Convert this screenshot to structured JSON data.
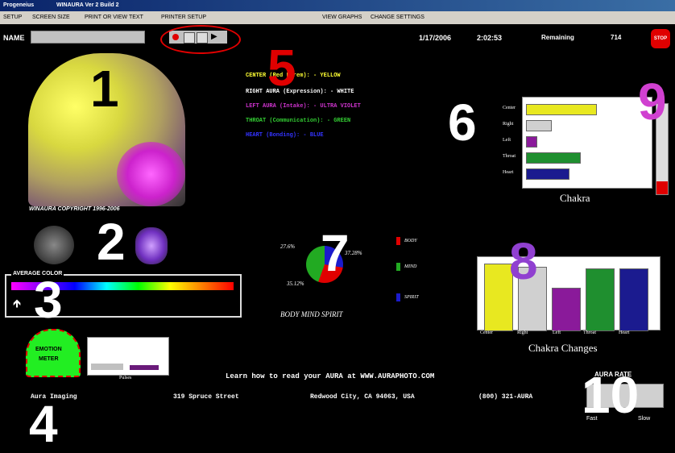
{
  "window": {
    "title_app": "Progeneius",
    "title_doc": "WINAURA Ver 2 Build 2"
  },
  "menu": {
    "items": [
      "SETUP",
      "SCREEN SIZE",
      "PRINT OR VIEW TEXT",
      "PRINTER SETUP",
      "VIEW GRAPHS",
      "CHANGE SETTINGS"
    ]
  },
  "toolbar": {
    "name_label": "NAME",
    "name_value": "",
    "date": "1/17/2006",
    "time": "2:02:53",
    "remaining_label": "Remaining",
    "remaining_value": "714",
    "stop_label": "STOP"
  },
  "annotations": [
    "1",
    "2",
    "3",
    "4",
    "5",
    "6",
    "7",
    "8",
    "9",
    "10"
  ],
  "copyright": "WINAURA COPYRIGHT 1996-2006",
  "chakra_legend": [
    {
      "label": "CENTER (Red Lorem): - YELLOW",
      "color": "#ffff33"
    },
    {
      "label": "RIGHT AURA (Expression): - WHITE",
      "color": "#ffffff"
    },
    {
      "label": "LEFT AURA (Intake): - ULTRA VIOLET",
      "color": "#cc33cc"
    },
    {
      "label": "THROAT (Communication): - GREEN",
      "color": "#33cc33"
    },
    {
      "label": "HEART (Bonding): - BLUE",
      "color": "#3333ff"
    }
  ],
  "average_color_label": "AVERAGE COLOR",
  "emotion_meter": {
    "label_top": "EMOTION",
    "label_bottom": "METER"
  },
  "small_chart_label": "Pulses",
  "pie": {
    "body_pct": "27.6%",
    "mind_pct": "37.28%",
    "spirit_pct": "35.12%",
    "caption": "BODY MIND SPIRIT",
    "legend": [
      "BODY",
      "MIND",
      "SPIRIT"
    ]
  },
  "chakra_hbar": {
    "caption": "Chakra",
    "labels": [
      "Center",
      "Right",
      "Left",
      "Throat",
      "Heart"
    ]
  },
  "chakra_changes": {
    "caption": "Chakra Changes",
    "labels": [
      "Center",
      "Right",
      "Left",
      "Throat",
      "Heart"
    ]
  },
  "footer": {
    "learn": "Learn how to read your AURA at WWW.AURAPHOTO.COM",
    "company": "Aura Imaging",
    "street": "319 Spruce Street",
    "city": "Redwood City, CA  94063, USA",
    "phone": "(800) 321-AURA",
    "aura_rate": "AURA RATE",
    "rate_fast": "Fast",
    "rate_slow": "Slow"
  },
  "colors": {
    "yellow": "#e8e820",
    "white": "#d8d8d8",
    "violet": "#8a1a9a",
    "green": "#1f8f2f",
    "blue": "#1b1b8f",
    "red": "#e00000",
    "magenta_num": "#d040d0",
    "purple_num": "#9040d0"
  }
}
